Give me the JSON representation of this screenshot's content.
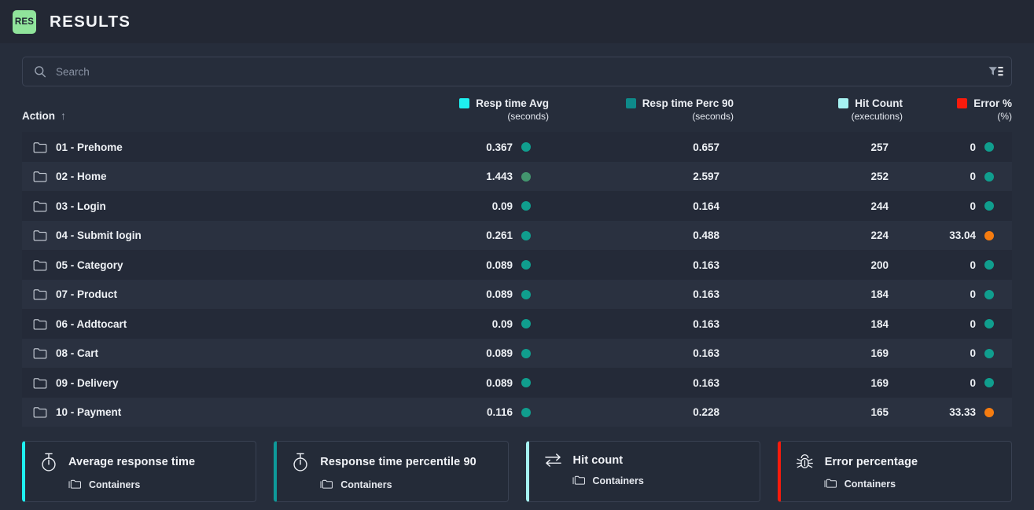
{
  "header": {
    "badge": "RES",
    "badge_color": "#90e49b",
    "title": "RESULTS"
  },
  "search": {
    "placeholder": "Search",
    "value": "",
    "search_icon": "search-icon",
    "filter_icon": "filter-list-icon"
  },
  "table": {
    "columns": [
      {
        "key": "action",
        "label": "Action",
        "unit": "",
        "swatch": "",
        "sorted": true,
        "sort_arrow": "↑"
      },
      {
        "key": "resp_time_avg",
        "label": "Resp time Avg",
        "unit": "(seconds)",
        "swatch": "#1ef0f0"
      },
      {
        "key": "resp_time_perc_90",
        "label": "Resp time Perc 90",
        "unit": "(seconds)",
        "swatch": "#0e8a8a"
      },
      {
        "key": "hit_count",
        "label": "Hit Count",
        "unit": "(executions)",
        "swatch": "#a6f2f2"
      },
      {
        "key": "error_pct",
        "label": "Error %",
        "unit": "(%)",
        "swatch": "#f91b0c"
      }
    ],
    "rows": [
      {
        "action": "01 - Prehome",
        "resp_time_avg": "0.367",
        "resp_time_avg_dot": "#109e8e",
        "resp_time_perc_90": "0.657",
        "hit_count": "257",
        "error_pct": "0",
        "error_pct_dot": "#109e8e"
      },
      {
        "action": "02 - Home",
        "resp_time_avg": "1.443",
        "resp_time_avg_dot": "#43956e",
        "resp_time_perc_90": "2.597",
        "hit_count": "252",
        "error_pct": "0",
        "error_pct_dot": "#109e8e"
      },
      {
        "action": "03 - Login",
        "resp_time_avg": "0.09",
        "resp_time_avg_dot": "#109e8e",
        "resp_time_perc_90": "0.164",
        "hit_count": "244",
        "error_pct": "0",
        "error_pct_dot": "#109e8e"
      },
      {
        "action": "04 - Submit login",
        "resp_time_avg": "0.261",
        "resp_time_avg_dot": "#109e8e",
        "resp_time_perc_90": "0.488",
        "hit_count": "224",
        "error_pct": "33.04",
        "error_pct_dot": "#f57c10"
      },
      {
        "action": "05 - Category",
        "resp_time_avg": "0.089",
        "resp_time_avg_dot": "#109e8e",
        "resp_time_perc_90": "0.163",
        "hit_count": "200",
        "error_pct": "0",
        "error_pct_dot": "#109e8e"
      },
      {
        "action": "07 - Product",
        "resp_time_avg": "0.089",
        "resp_time_avg_dot": "#109e8e",
        "resp_time_perc_90": "0.163",
        "hit_count": "184",
        "error_pct": "0",
        "error_pct_dot": "#109e8e"
      },
      {
        "action": "06 - Addtocart",
        "resp_time_avg": "0.09",
        "resp_time_avg_dot": "#109e8e",
        "resp_time_perc_90": "0.163",
        "hit_count": "184",
        "error_pct": "0",
        "error_pct_dot": "#109e8e"
      },
      {
        "action": "08 - Cart",
        "resp_time_avg": "0.089",
        "resp_time_avg_dot": "#109e8e",
        "resp_time_perc_90": "0.163",
        "hit_count": "169",
        "error_pct": "0",
        "error_pct_dot": "#109e8e"
      },
      {
        "action": "09 - Delivery",
        "resp_time_avg": "0.089",
        "resp_time_avg_dot": "#109e8e",
        "resp_time_perc_90": "0.163",
        "hit_count": "169",
        "error_pct": "0",
        "error_pct_dot": "#109e8e"
      },
      {
        "action": "10 - Payment",
        "resp_time_avg": "0.116",
        "resp_time_avg_dot": "#109e8e",
        "resp_time_perc_90": "0.228",
        "hit_count": "165",
        "error_pct": "33.33",
        "error_pct_dot": "#f57c10"
      }
    ]
  },
  "cards": [
    {
      "title": "Average response time",
      "sub": "Containers",
      "icon": "stopwatch-icon",
      "accent": "#1ef0f0"
    },
    {
      "title": "Response time percentile 90",
      "sub": "Containers",
      "icon": "stopwatch-icon",
      "accent": "#0e9a9a"
    },
    {
      "title": "Hit count",
      "sub": "Containers",
      "icon": "exchange-arrows-icon",
      "accent": "#a6f2f2"
    },
    {
      "title": "Error percentage",
      "sub": "Containers",
      "icon": "bug-icon",
      "accent": "#f91b0c"
    }
  ]
}
